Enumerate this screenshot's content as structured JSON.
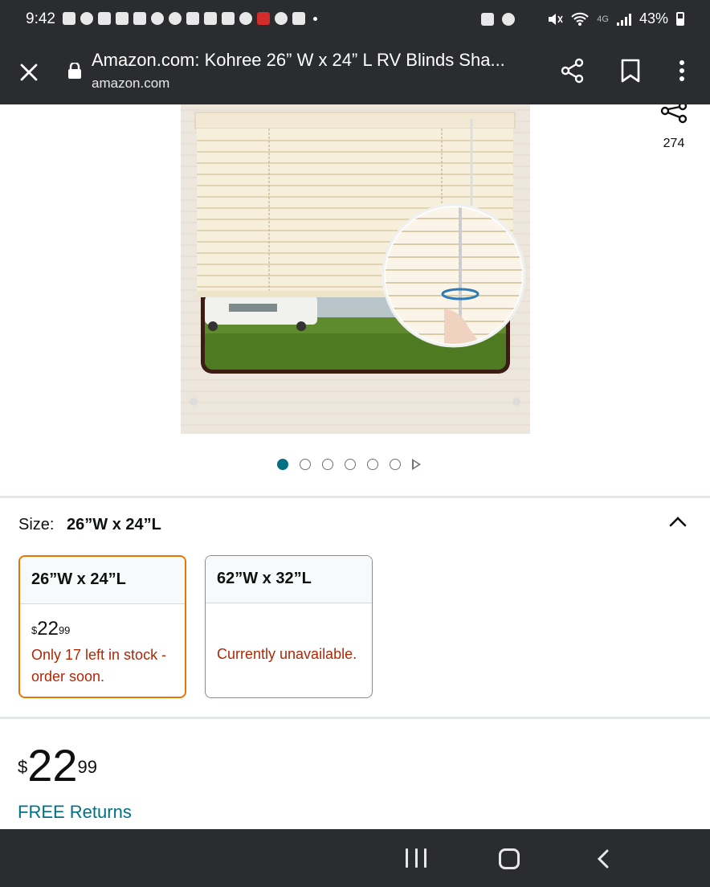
{
  "status_bar": {
    "time": "9:42",
    "battery": "43%",
    "network": "4G"
  },
  "browser": {
    "page_title": "Amazon.com: Kohree 26” W x 24” L RV Blinds Sha...",
    "domain": "amazon.com",
    "icons": [
      "close-icon",
      "lock-icon",
      "share-icon",
      "bookmark-icon",
      "more-vert-icon"
    ]
  },
  "gallery": {
    "share_count": "274",
    "image_count": 6,
    "active_index": 0
  },
  "size": {
    "label": "Size:",
    "selected": "26”W x 24”L",
    "options": [
      {
        "name": "26”W x 24”L",
        "price_symbol": "$",
        "price_whole": "22",
        "price_fraction": "99",
        "availability": "Only 17 left in stock - order soon.",
        "selected": true
      },
      {
        "name": "62”W x 32”L",
        "price_symbol": "",
        "price_whole": "",
        "price_fraction": "",
        "availability": "Currently unavailable.",
        "selected": false
      }
    ]
  },
  "price": {
    "symbol": "$",
    "whole": "22",
    "fraction": "99"
  },
  "returns": "FREE Returns",
  "colors": {
    "bar_bg": "#2b2c2f",
    "accent_teal": "#007185",
    "stock_red": "#b12704",
    "selected_orange": "#e77600"
  }
}
